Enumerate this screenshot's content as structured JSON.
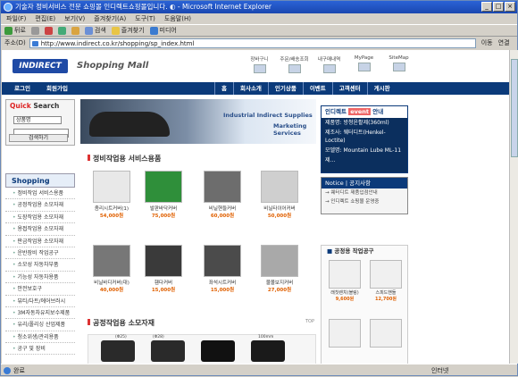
{
  "window": {
    "title": "기술자 정비서비스 전문 쇼핑몰 인디렉트쇼핑몰입니다. ◐ - Microsoft Internet Explorer",
    "btn_min": "_",
    "btn_max": "□",
    "btn_close": "×"
  },
  "menu": [
    "파일(F)",
    "편집(E)",
    "보기(V)",
    "즐겨찾기(A)",
    "도구(T)",
    "도움말(H)"
  ],
  "toolbar": {
    "back": "뒤로",
    "search": "검색",
    "favorites": "즐겨찾기",
    "media": "미디어"
  },
  "address": {
    "label": "주소(D)",
    "url": "http://www.indirect.co.kr/shopping/sp_index.html",
    "go": "이동",
    "links": "연결"
  },
  "status": {
    "text": "완료",
    "zone": "인터넷"
  },
  "site": {
    "logo": "INDIRECT",
    "mall": "Shopping Mall",
    "topnav": [
      "장바구니",
      "주문/배송조회",
      "내구매내역",
      "MyPage",
      "SiteMap"
    ],
    "mainnav_left": [
      "로그인",
      "회원가입"
    ],
    "mainnav_right": [
      "홈",
      "회사소개",
      "인기상품",
      "이벤트",
      "고객센터",
      "게시판"
    ]
  },
  "quick": {
    "title_red": "Quick",
    "title": "Search",
    "select": "상품명",
    "button": "검색하기"
  },
  "category": {
    "header": "Shopping",
    "items": [
      "정비작업 서비스용품",
      "공정작업용 소모자재",
      "도장작업용 소모자재",
      "용접작업용 소모자재",
      "판금작업용 소모자재",
      "운반장비 작업공구",
      "소모성 자동차부품",
      "기능성 자동차용품",
      "안전보호구",
      "뷰티/다트/에어브러시",
      "3M자동차유지보수제품",
      "유리/폴리싱 산업제품",
      "청소위생/관리용품",
      "공구 및 장비"
    ]
  },
  "banner": {
    "line1": "Industrial Indirect Supplies",
    "line2": "Marketing Services"
  },
  "section1": {
    "title": "정비작업용 서비스용품"
  },
  "products": [
    {
      "name": "좀리시트커버(1)",
      "price": "54,000원"
    },
    {
      "name": "발판바닥커버",
      "price": "75,000원"
    },
    {
      "name": "비닐핸들커버",
      "price": "60,000원"
    },
    {
      "name": "비닐타이어커버",
      "price": "50,000원"
    },
    {
      "name": "비닐바디커버(대)",
      "price": "40,000원"
    },
    {
      "name": "휀다커버",
      "price": "15,000원"
    },
    {
      "name": "좌석시트커버",
      "price": "15,000원"
    },
    {
      "name": "물몰보지커버",
      "price": "27,000원"
    }
  ],
  "section2": {
    "title": "공정작업용 소모자재",
    "top": "TOP"
  },
  "parts": [
    "(Φ25)",
    "(Φ28)",
    "",
    "100mm"
  ],
  "event": {
    "title": "인디렉트",
    "badge": "event",
    "suffix": "안내",
    "lines": [
      "제품명: 방청윤활제(360ml)",
      "제조사: 웨터디트(Henkel-Loctite)",
      "모델명: Mountain Lube ML-11",
      "제..."
    ]
  },
  "notice": {
    "title": "Notice | 공지사항",
    "lines": [
      "→ 웨터디트 제품입점안내",
      "→ 인디렉트 쇼핑몰 운영중"
    ]
  },
  "tools": {
    "title": "공정용 작업공구",
    "items": [
      {
        "name": "래칫렌치(블링)",
        "price": "9,600원"
      },
      {
        "name": "스피드핸들",
        "price": "12,700원"
      },
      {
        "name": "",
        "price": ""
      },
      {
        "name": "",
        "price": ""
      }
    ]
  }
}
